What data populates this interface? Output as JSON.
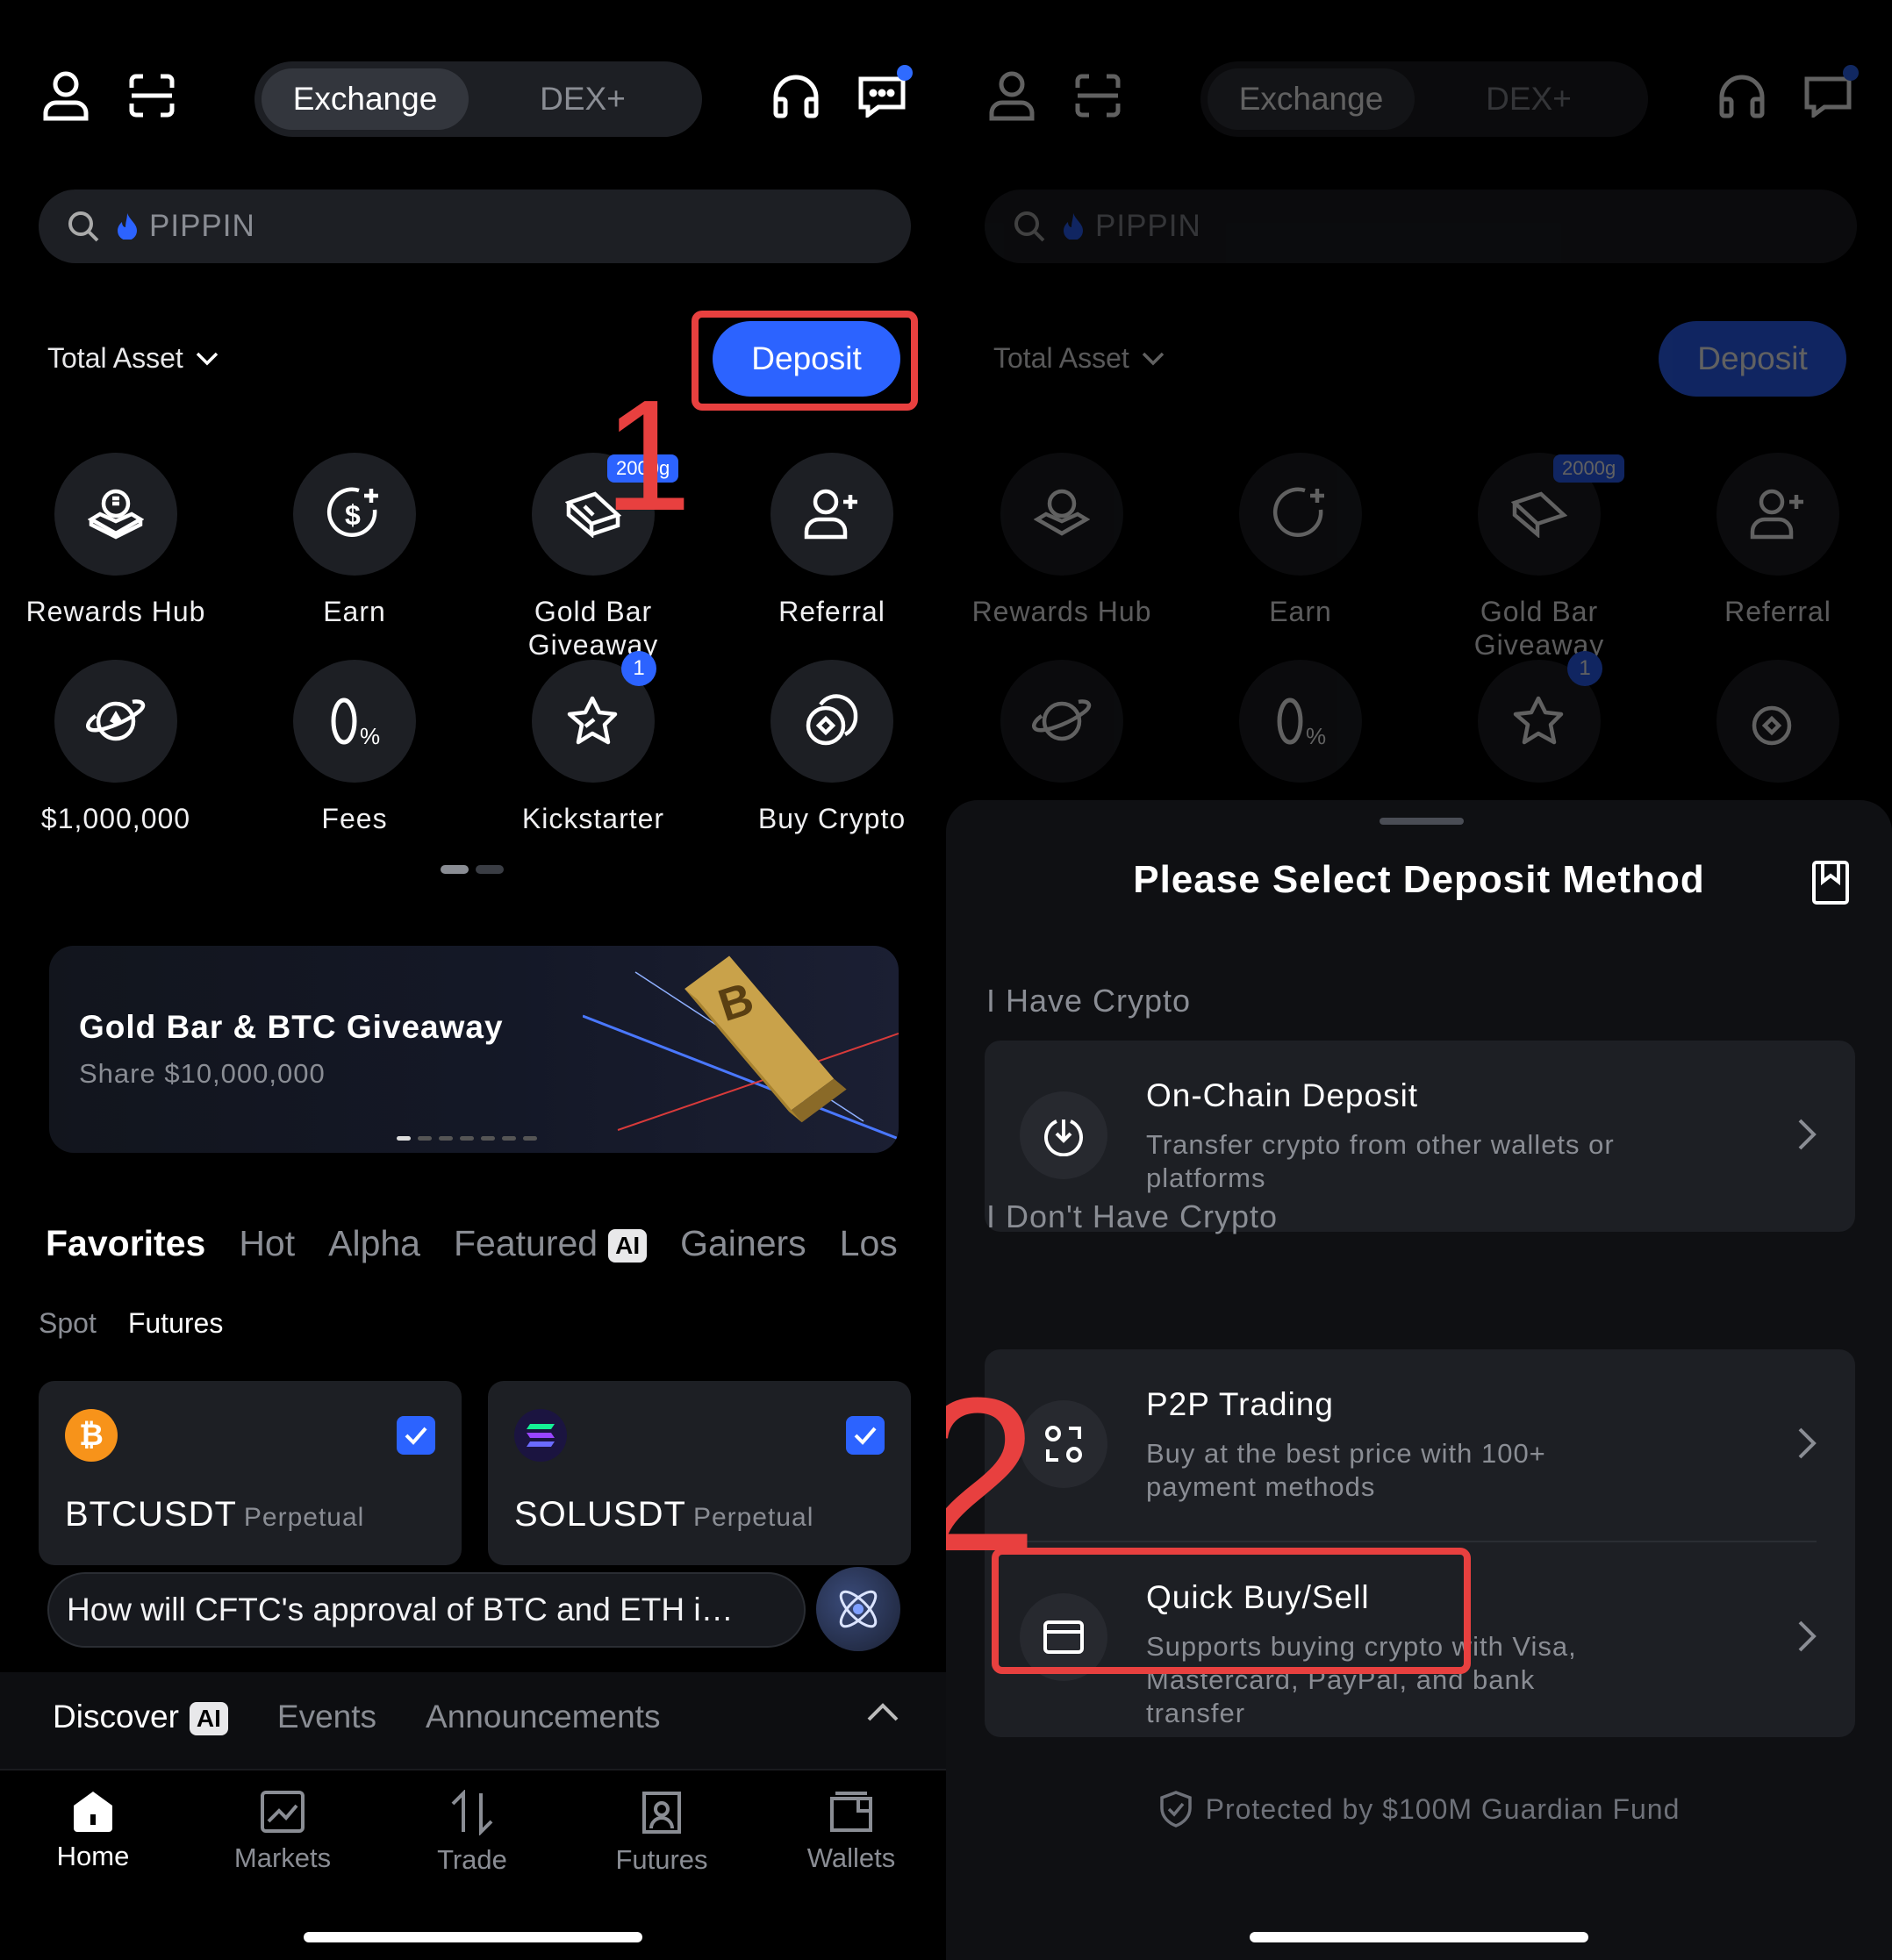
{
  "header": {
    "segment_active": "Exchange",
    "segment_inactive": "DEX+",
    "icons": [
      "user-icon",
      "scan-icon",
      "headset-icon",
      "message-icon"
    ]
  },
  "search": {
    "placeholder": "PIPPIN"
  },
  "assets": {
    "label": "Total Asset",
    "deposit": "Deposit"
  },
  "grid": [
    {
      "label": "Rewards Hub",
      "icon": "rewards-icon"
    },
    {
      "label": "Earn",
      "icon": "earn-icon"
    },
    {
      "label": "Gold Bar Giveaway",
      "icon": "gold-bar-icon",
      "badge": "2000g"
    },
    {
      "label": "Referral",
      "icon": "referral-icon"
    },
    {
      "label": "$1,000,000",
      "icon": "planet-icon"
    },
    {
      "label": "Fees",
      "icon": "fees-icon"
    },
    {
      "label": "Kickstarter",
      "icon": "kickstarter-icon",
      "badge": "1"
    },
    {
      "label": "Buy Crypto",
      "icon": "buy-crypto-icon"
    }
  ],
  "banner": {
    "title": "Gold Bar & BTC Giveaway",
    "subtitle": "Share $10,000,000"
  },
  "market_tabs": [
    "Favorites",
    "Hot",
    "Alpha",
    "Featured",
    "Gainers",
    "Los"
  ],
  "ai_badge": "AI",
  "sub_tabs": [
    "Spot",
    "Futures"
  ],
  "coins": [
    {
      "symbol": "BTCUSDT",
      "type": "Perpetual",
      "color": "#f7931a"
    },
    {
      "symbol": "SOLUSDT",
      "type": "Perpetual",
      "color": "#6b3df0"
    }
  ],
  "ask_prompt": "How will CFTC's approval of BTC and ETH i…",
  "discover": {
    "items": [
      "Discover",
      "Events",
      "Announcements"
    ]
  },
  "nav": [
    "Home",
    "Markets",
    "Trade",
    "Futures",
    "Wallets"
  ],
  "sheet": {
    "title": "Please Select Deposit Method",
    "section1": "I Have Crypto",
    "section2": "I Don't Have Crypto",
    "options": [
      {
        "title": "On-Chain Deposit",
        "desc": "Transfer crypto from other wallets or platforms"
      },
      {
        "title": "P2P Trading",
        "desc": "Buy at the best price with 100+ payment methods"
      },
      {
        "title": "Quick Buy/Sell",
        "desc": "Supports buying crypto with Visa, Mastercard, PayPal, and bank transfer"
      }
    ],
    "guard": "Protected by $100M Guardian Fund"
  },
  "annotations": {
    "step1": "1",
    "step2": "2"
  },
  "colors": {
    "accent": "#2c63ff",
    "annotation": "#e8403f"
  }
}
